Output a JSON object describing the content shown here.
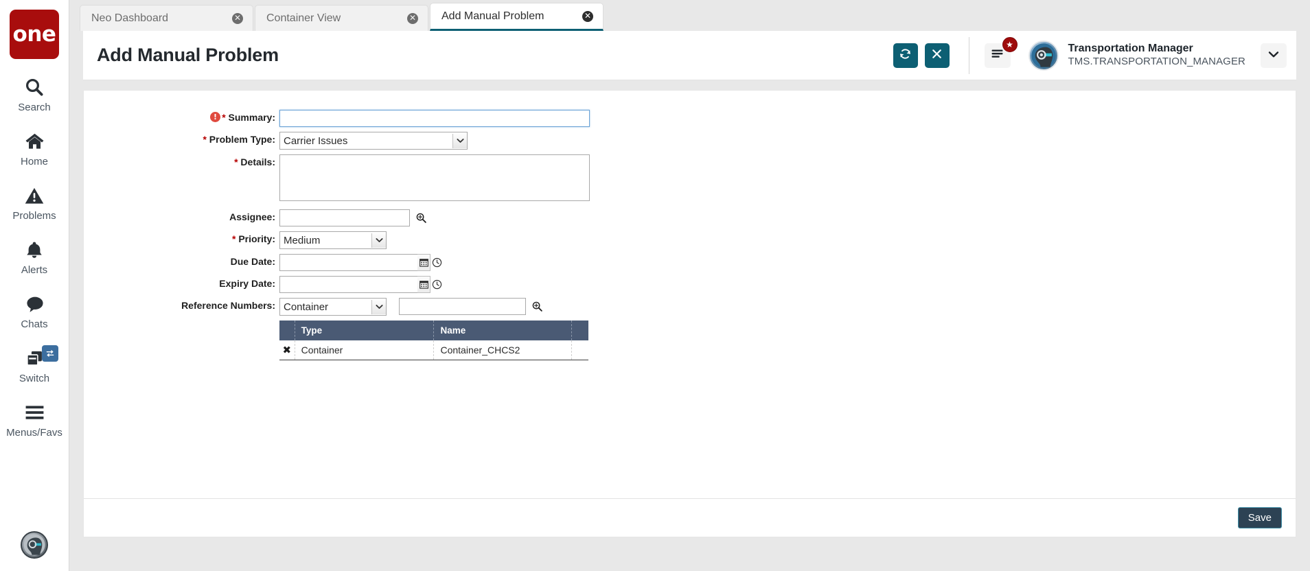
{
  "sidebar": {
    "logo_text": "one",
    "items": [
      {
        "label": "Search",
        "icon": "search-icon"
      },
      {
        "label": "Home",
        "icon": "home-icon"
      },
      {
        "label": "Problems",
        "icon": "warning-triangle-icon"
      },
      {
        "label": "Alerts",
        "icon": "bell-icon"
      },
      {
        "label": "Chats",
        "icon": "chat-bubble-icon"
      },
      {
        "label": "Switch",
        "icon": "windows-stack-icon"
      },
      {
        "label": "Menus/Favs",
        "icon": "hamburger-icon"
      }
    ],
    "avatar_alt": "user-avatar"
  },
  "tabs": [
    {
      "label": "Neo Dashboard",
      "active": false,
      "close": "✕"
    },
    {
      "label": "Container View",
      "active": false,
      "close": "✕"
    },
    {
      "label": "Add Manual Problem",
      "active": true,
      "close": "✕"
    }
  ],
  "header": {
    "title": "Add Manual Problem",
    "refresh_icon": "refresh-icon",
    "close_icon": "close-icon",
    "menu_icon": "hamburger-icon",
    "star_badge": "★",
    "user_name": "Transportation Manager",
    "user_role": "TMS.TRANSPORTATION_MANAGER",
    "caret_icon": "chevron-down-icon"
  },
  "form": {
    "summary": {
      "label": "Summary:",
      "required": true,
      "error_icon": "!",
      "value": "",
      "placeholder": ""
    },
    "problem_type": {
      "label": "Problem Type:",
      "required": true,
      "value": "Carrier Issues",
      "options": [
        "Carrier Issues"
      ]
    },
    "details": {
      "label": "Details:",
      "required": true,
      "value": "",
      "placeholder": ""
    },
    "assignee": {
      "label": "Assignee:",
      "required": false,
      "value": "",
      "search_icon": "magnifier-icon"
    },
    "priority": {
      "label": "Priority:",
      "required": true,
      "value": "Medium",
      "options": [
        "Medium"
      ]
    },
    "due_date": {
      "label": "Due Date:",
      "required": false,
      "value": "",
      "calendar_icon": "calendar-icon",
      "clock_icon": "clock-icon"
    },
    "expiry_date": {
      "label": "Expiry Date:",
      "required": false,
      "value": "",
      "calendar_icon": "calendar-icon",
      "clock_icon": "clock-icon"
    },
    "reference_numbers": {
      "label": "Reference Numbers:",
      "required": false,
      "type_value": "Container",
      "type_options": [
        "Container"
      ],
      "search_value": "",
      "search_icon": "magnifier-icon"
    }
  },
  "ref_table": {
    "columns": [
      "",
      "Type",
      "Name",
      ""
    ],
    "rows": [
      {
        "delete": "✖",
        "type": "Container",
        "name": "Container_CHCS2"
      }
    ]
  },
  "footer": {
    "save_label": "Save"
  },
  "colors": {
    "brand_red": "#a80d0d",
    "accent_teal": "#0d5f73",
    "table_header": "#4a5a74",
    "save_bg": "#2d4254",
    "save_border": "#3d8fa8",
    "switch_badge": "#3c6e9f",
    "error_red": "#e04a3f",
    "required_red": "#b60000"
  }
}
